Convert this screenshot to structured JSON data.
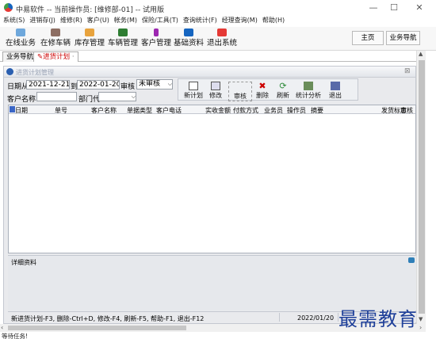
{
  "window": {
    "title": "中易软件 -- 当前操作员: [维修部-01]  -- 试用版",
    "min": "—",
    "max": "☐",
    "close": "✕"
  },
  "menu": [
    "系统(S)",
    "进销存(J)",
    "维修(R)",
    "客户(U)",
    "帐务(M)",
    "保险/工具(T)",
    "查询统计(F)",
    "经理查询(M)",
    "帮助(H)"
  ],
  "toolbar": [
    {
      "label": "在线业务",
      "icon": "folder-icon",
      "color": "#6fa8dc"
    },
    {
      "label": "在修车辆",
      "icon": "tools-icon",
      "color": "#8d6e63"
    },
    {
      "label": "库存管理",
      "icon": "box-icon",
      "color": "#e8a33d"
    },
    {
      "label": "车辆管理",
      "icon": "car-icon",
      "color": "#2e7d32"
    },
    {
      "label": "客户管理",
      "icon": "person-icon",
      "color": "#9c27b0"
    },
    {
      "label": "基础资料",
      "icon": "monitor-icon",
      "color": "#1565c0"
    },
    {
      "label": "退出系统",
      "icon": "exit-icon",
      "color": "#e53935"
    }
  ],
  "right_buttons": {
    "home": "主页",
    "nav": "业务导航"
  },
  "tabs": [
    {
      "label": "业务导航",
      "active": false
    },
    {
      "label": "进货计划",
      "active": true
    }
  ],
  "inner": {
    "title": "进货计划管理",
    "close": "⊠",
    "date_label": "日期从",
    "date_from": "2021-12-21",
    "to_label": "到",
    "date_to": "2022-01-20",
    "audit_label": "审核",
    "audit_value": "未审核",
    "customer_label": "客户名称:",
    "customer_value": "",
    "dept_label": "部门代",
    "dept_value": "",
    "actions": [
      "新计划",
      "修改",
      "审核",
      "删除",
      "刷新",
      "统计分析",
      "退出"
    ],
    "columns": [
      "日期",
      "单号",
      "客户名称",
      "单据类型",
      "客户电话",
      "实收金额",
      "付款方式",
      "业务员",
      "操作员",
      "摘要",
      "发货标志",
      "审核"
    ],
    "detail_label": "详细资料",
    "status_help": "新进货计划-F3, 删除-Ctrl+D, 修改-F4, 刷新-F5, 帮助-F1, 退出-F12",
    "status_date": "2022/01/20"
  },
  "bottom_status": "等待任务!",
  "watermark": "最需教育"
}
